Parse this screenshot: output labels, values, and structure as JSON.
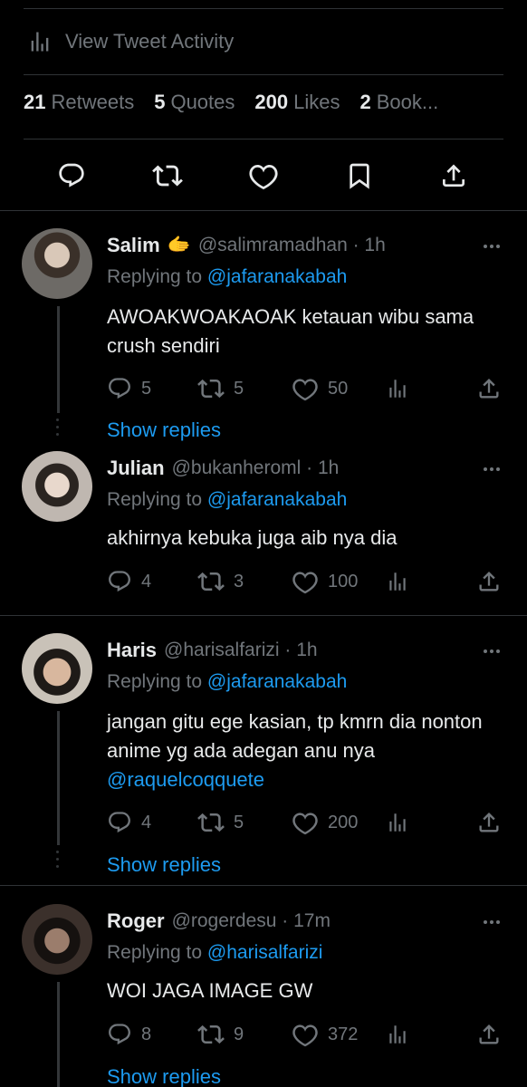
{
  "activity": {
    "label": "View Tweet Activity",
    "icon": "analytics-icon"
  },
  "stats": [
    {
      "count": "21",
      "label": "Retweets"
    },
    {
      "count": "5",
      "label": "Quotes"
    },
    {
      "count": "200",
      "label": "Likes"
    },
    {
      "count": "2",
      "label": "Book..."
    }
  ],
  "colors": {
    "accent": "#1d9bf0",
    "muted": "#71767b",
    "background": "#000000",
    "divider": "#2f3336"
  },
  "replies": [
    {
      "name": "Salim",
      "emoji": "🫱",
      "meta": "@salimramadhan · 1h",
      "replying_prefix": "Replying to ",
      "replying_to": "@jafaranakabah",
      "text": "AWOAKWOAKAOAK ketauan wibu sama crush sendiri",
      "replies": "5",
      "retweets": "5",
      "likes": "50",
      "show_replies": "Show replies"
    },
    {
      "name": "Julian",
      "meta": "@bukanheroml · 1h",
      "replying_prefix": "Replying to ",
      "replying_to": "@jafaranakabah",
      "text": "akhirnya kebuka juga aib nya dia",
      "replies": "4",
      "retweets": "3",
      "likes": "100"
    },
    {
      "name": "Haris",
      "meta": "@harisalfarizi · 1h",
      "replying_prefix": "Replying to ",
      "replying_to": "@jafaranakabah",
      "text": "jangan gitu ege kasian, tp kmrn dia nonton anime yg ada adegan anu nya",
      "mention": "@raquelcoqquete",
      "replies": "4",
      "retweets": "5",
      "likes": "200",
      "show_replies": "Show replies"
    },
    {
      "name": "Roger",
      "meta": "@rogerdesu · 17m",
      "replying_prefix": "Replying to ",
      "replying_to": "@harisalfarizi",
      "text": "WOI JAGA IMAGE GW",
      "replies": "8",
      "retweets": "9",
      "likes": "372",
      "show_replies": "Show replies"
    }
  ]
}
